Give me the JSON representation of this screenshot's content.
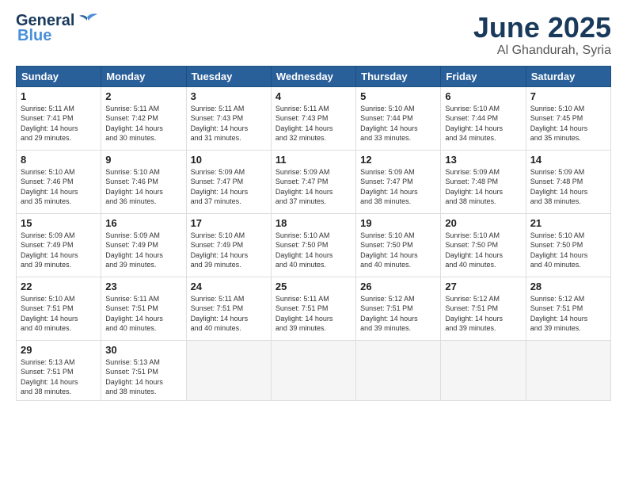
{
  "header": {
    "logo_line1": "General",
    "logo_line2": "Blue",
    "month": "June 2025",
    "location": "Al Ghandurah, Syria"
  },
  "days_of_week": [
    "Sunday",
    "Monday",
    "Tuesday",
    "Wednesday",
    "Thursday",
    "Friday",
    "Saturday"
  ],
  "weeks": [
    [
      {
        "day": "1",
        "info": "Sunrise: 5:11 AM\nSunset: 7:41 PM\nDaylight: 14 hours\nand 29 minutes."
      },
      {
        "day": "2",
        "info": "Sunrise: 5:11 AM\nSunset: 7:42 PM\nDaylight: 14 hours\nand 30 minutes."
      },
      {
        "day": "3",
        "info": "Sunrise: 5:11 AM\nSunset: 7:43 PM\nDaylight: 14 hours\nand 31 minutes."
      },
      {
        "day": "4",
        "info": "Sunrise: 5:11 AM\nSunset: 7:43 PM\nDaylight: 14 hours\nand 32 minutes."
      },
      {
        "day": "5",
        "info": "Sunrise: 5:10 AM\nSunset: 7:44 PM\nDaylight: 14 hours\nand 33 minutes."
      },
      {
        "day": "6",
        "info": "Sunrise: 5:10 AM\nSunset: 7:44 PM\nDaylight: 14 hours\nand 34 minutes."
      },
      {
        "day": "7",
        "info": "Sunrise: 5:10 AM\nSunset: 7:45 PM\nDaylight: 14 hours\nand 35 minutes."
      }
    ],
    [
      {
        "day": "8",
        "info": "Sunrise: 5:10 AM\nSunset: 7:46 PM\nDaylight: 14 hours\nand 35 minutes."
      },
      {
        "day": "9",
        "info": "Sunrise: 5:10 AM\nSunset: 7:46 PM\nDaylight: 14 hours\nand 36 minutes."
      },
      {
        "day": "10",
        "info": "Sunrise: 5:09 AM\nSunset: 7:47 PM\nDaylight: 14 hours\nand 37 minutes."
      },
      {
        "day": "11",
        "info": "Sunrise: 5:09 AM\nSunset: 7:47 PM\nDaylight: 14 hours\nand 37 minutes."
      },
      {
        "day": "12",
        "info": "Sunrise: 5:09 AM\nSunset: 7:47 PM\nDaylight: 14 hours\nand 38 minutes."
      },
      {
        "day": "13",
        "info": "Sunrise: 5:09 AM\nSunset: 7:48 PM\nDaylight: 14 hours\nand 38 minutes."
      },
      {
        "day": "14",
        "info": "Sunrise: 5:09 AM\nSunset: 7:48 PM\nDaylight: 14 hours\nand 38 minutes."
      }
    ],
    [
      {
        "day": "15",
        "info": "Sunrise: 5:09 AM\nSunset: 7:49 PM\nDaylight: 14 hours\nand 39 minutes."
      },
      {
        "day": "16",
        "info": "Sunrise: 5:09 AM\nSunset: 7:49 PM\nDaylight: 14 hours\nand 39 minutes."
      },
      {
        "day": "17",
        "info": "Sunrise: 5:10 AM\nSunset: 7:49 PM\nDaylight: 14 hours\nand 39 minutes."
      },
      {
        "day": "18",
        "info": "Sunrise: 5:10 AM\nSunset: 7:50 PM\nDaylight: 14 hours\nand 40 minutes."
      },
      {
        "day": "19",
        "info": "Sunrise: 5:10 AM\nSunset: 7:50 PM\nDaylight: 14 hours\nand 40 minutes."
      },
      {
        "day": "20",
        "info": "Sunrise: 5:10 AM\nSunset: 7:50 PM\nDaylight: 14 hours\nand 40 minutes."
      },
      {
        "day": "21",
        "info": "Sunrise: 5:10 AM\nSunset: 7:50 PM\nDaylight: 14 hours\nand 40 minutes."
      }
    ],
    [
      {
        "day": "22",
        "info": "Sunrise: 5:10 AM\nSunset: 7:51 PM\nDaylight: 14 hours\nand 40 minutes."
      },
      {
        "day": "23",
        "info": "Sunrise: 5:11 AM\nSunset: 7:51 PM\nDaylight: 14 hours\nand 40 minutes."
      },
      {
        "day": "24",
        "info": "Sunrise: 5:11 AM\nSunset: 7:51 PM\nDaylight: 14 hours\nand 40 minutes."
      },
      {
        "day": "25",
        "info": "Sunrise: 5:11 AM\nSunset: 7:51 PM\nDaylight: 14 hours\nand 39 minutes."
      },
      {
        "day": "26",
        "info": "Sunrise: 5:12 AM\nSunset: 7:51 PM\nDaylight: 14 hours\nand 39 minutes."
      },
      {
        "day": "27",
        "info": "Sunrise: 5:12 AM\nSunset: 7:51 PM\nDaylight: 14 hours\nand 39 minutes."
      },
      {
        "day": "28",
        "info": "Sunrise: 5:12 AM\nSunset: 7:51 PM\nDaylight: 14 hours\nand 39 minutes."
      }
    ],
    [
      {
        "day": "29",
        "info": "Sunrise: 5:13 AM\nSunset: 7:51 PM\nDaylight: 14 hours\nand 38 minutes."
      },
      {
        "day": "30",
        "info": "Sunrise: 5:13 AM\nSunset: 7:51 PM\nDaylight: 14 hours\nand 38 minutes."
      },
      {
        "day": "",
        "info": ""
      },
      {
        "day": "",
        "info": ""
      },
      {
        "day": "",
        "info": ""
      },
      {
        "day": "",
        "info": ""
      },
      {
        "day": "",
        "info": ""
      }
    ]
  ]
}
